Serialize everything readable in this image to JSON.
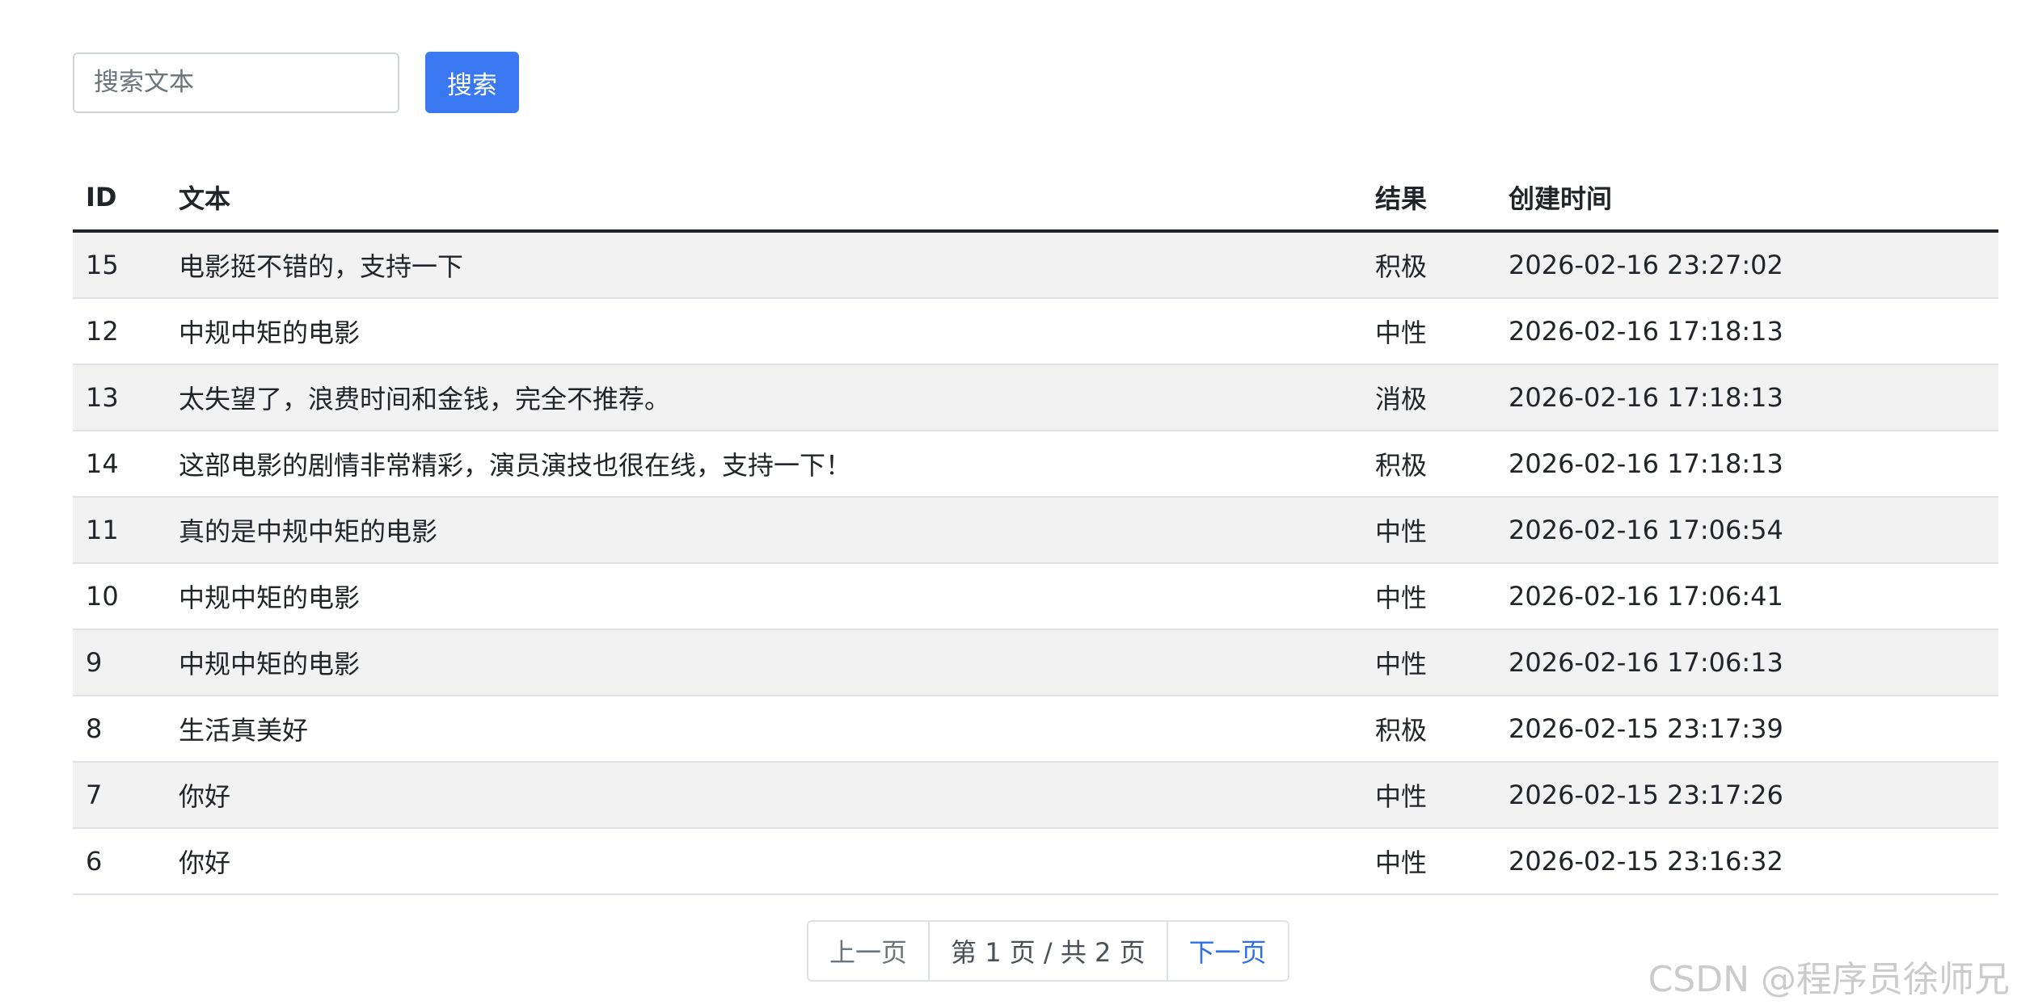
{
  "search": {
    "placeholder": "搜索文本",
    "value": "",
    "button_label": "搜索"
  },
  "table": {
    "headers": {
      "id": "ID",
      "text": "文本",
      "result": "结果",
      "created_at": "创建时间"
    },
    "rows": [
      {
        "id": "15",
        "text": "电影挺不错的，支持一下",
        "result": "积极",
        "created_at": "2026-02-16 23:27:02"
      },
      {
        "id": "12",
        "text": "中规中矩的电影",
        "result": "中性",
        "created_at": "2026-02-16 17:18:13"
      },
      {
        "id": "13",
        "text": "太失望了，浪费时间和金钱，完全不推荐。",
        "result": "消极",
        "created_at": "2026-02-16 17:18:13"
      },
      {
        "id": "14",
        "text": "这部电影的剧情非常精彩，演员演技也很在线，支持一下！",
        "result": "积极",
        "created_at": "2026-02-16 17:18:13"
      },
      {
        "id": "11",
        "text": "真的是中规中矩的电影",
        "result": "中性",
        "created_at": "2026-02-16 17:06:54"
      },
      {
        "id": "10",
        "text": "中规中矩的电影",
        "result": "中性",
        "created_at": "2026-02-16 17:06:41"
      },
      {
        "id": "9",
        "text": "中规中矩的电影",
        "result": "中性",
        "created_at": "2026-02-16 17:06:13"
      },
      {
        "id": "8",
        "text": "生活真美好",
        "result": "积极",
        "created_at": "2026-02-15 23:17:39"
      },
      {
        "id": "7",
        "text": "你好",
        "result": "中性",
        "created_at": "2026-02-15 23:17:26"
      },
      {
        "id": "6",
        "text": "你好",
        "result": "中性",
        "created_at": "2026-02-15 23:16:32"
      }
    ]
  },
  "pagination": {
    "prev_label": "上一页",
    "info": "第 1 页 / 共 2 页",
    "next_label": "下一页"
  },
  "watermark": "CSDN @程序员徐师兄",
  "colors": {
    "accent": "#3a78f2",
    "link": "#2f6fea",
    "stripe": "#f2f2f2"
  }
}
